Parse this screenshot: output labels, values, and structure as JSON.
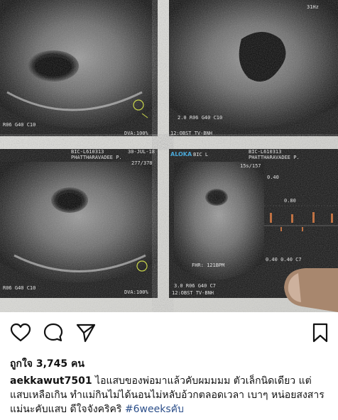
{
  "post": {
    "like_label": "ถูกใจ",
    "like_count": "3,745",
    "like_unit": "คน",
    "username": "aekkawut7501",
    "caption_part1": "ไอแสบของพ่อมาแล้วคับผมมมม ตัวเล็กนิดเดียว แต่แสบเหลือเกิน ทำแม่กินไม่ได้นอนไม่หลับอ้วกตลอดเวลา เบาๆ หน่อยสงสารแม่นะคับแสบ ดีใจจังคริคริ",
    "hashtag": "#6weeksคับ"
  },
  "icons": {
    "like": "heart-outline-icon",
    "comment": "comment-bubble-icon",
    "share": "paper-plane-icon",
    "save": "bookmark-icon"
  },
  "photo": {
    "overlay_texts": {
      "tl_bottom_left": "R06 G40 C10",
      "tl_bottom_right": "DVA:100%",
      "tr_top_right": "31Hz",
      "tr_bottom_left": "12:OBST TV-BNH",
      "tr_bottom_mid": "2.0 R06 G40 C10",
      "bl_header1": "BIC-L610313",
      "bl_header2": "PHATTHARAVADEE P.",
      "bl_header3": "30-JUL-18",
      "bl_header4": "277/378",
      "bl_bottom_left": "R06 G40 C10",
      "bl_bottom_right": "DVA:100%",
      "br_header_brand": "ALOKA",
      "br_header1": "BIC L",
      "br_header2": "BIC-L610313",
      "br_header3": "PHATTHARAVADEE P.",
      "br_header4": "15s/157",
      "br_fhr": "FHR: 121BPM",
      "br_bottom_left": "3.0 R06 G40 C7",
      "br_bottom_mid": "12:OBST TV-BNH",
      "br_scale_top": "0.40",
      "br_scale_mid": "0.80",
      "br_scale_bottom": "0.40 0.40 C7"
    }
  }
}
